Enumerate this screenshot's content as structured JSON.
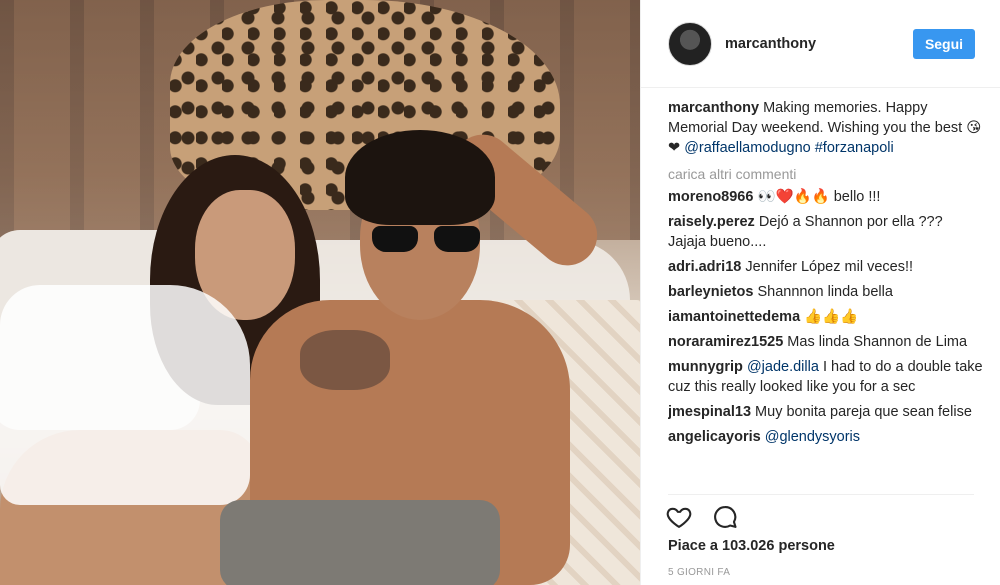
{
  "post": {
    "username": "marcanthony",
    "follow_label": "Segui"
  },
  "caption": {
    "username": "marcanthony",
    "text": "Making memories. Happy Memorial Day weekend. Wishing you the best 😘 ❤",
    "mention1": "@raffaellamodugno",
    "hashtag": "#forzanapoli"
  },
  "load_more_label": "carica altri commenti",
  "comments": [
    {
      "user": "moreno8966",
      "text": "👀❤️🔥🔥 bello !!!",
      "mention": ""
    },
    {
      "user": "raisely.perez",
      "text": "Dejó a Shannon por ella ??? Jajaja bueno....",
      "mention": ""
    },
    {
      "user": "adri.adri18",
      "text": "Jennifer López mil veces!!",
      "mention": ""
    },
    {
      "user": "barleynietos",
      "text": "Shannnon linda bella",
      "mention": ""
    },
    {
      "user": "iamantoinettedema",
      "text": "👍👍👍",
      "mention": ""
    },
    {
      "user": "noraramirez1525",
      "text": "Mas linda Shannon de Lima",
      "mention": ""
    },
    {
      "user": "munnygrip",
      "mention": "@jade.dilla",
      "text": "I had to do a double take cuz this really looked like you for a sec"
    },
    {
      "user": "jmespinal13",
      "text": "Muy bonita pareja que sean felise",
      "mention": ""
    },
    {
      "user": "angelicayoris",
      "mention": "@glendysyoris",
      "text": ""
    }
  ],
  "likes_text": "Piace a 103.026 persone",
  "timestamp": "5 GIORNI FA",
  "icons": {
    "like": "heart-icon",
    "comment": "comment-bubble-icon"
  }
}
